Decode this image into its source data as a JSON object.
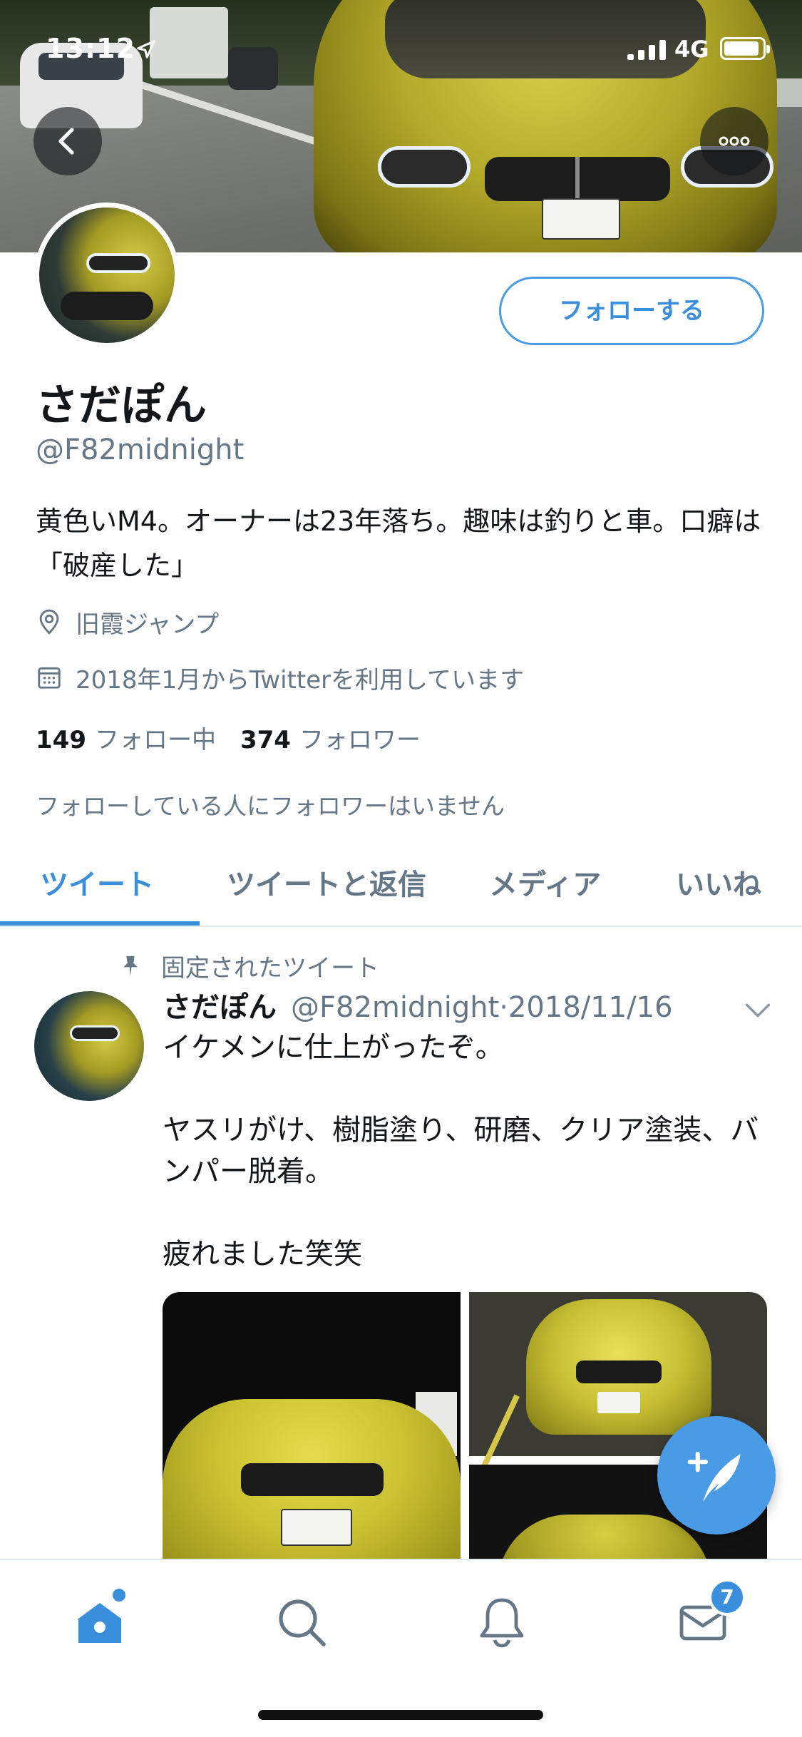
{
  "status_bar": {
    "time": "13:12",
    "network": "4G"
  },
  "profile": {
    "follow_label": "フォローする",
    "name": "さだぽん",
    "handle": "@F82midnight",
    "bio": "黄色いM4。オーナーは23年落ち。趣味は釣りと車。口癖は「破産した」",
    "location": "旧霞ジャンプ",
    "joined": "2018年1月からTwitterを利用しています",
    "following_count": "149",
    "following_label": "フォロー中",
    "followers_count": "374",
    "followers_label": "フォロワー",
    "followers_note": "フォローしている人にフォロワーはいません"
  },
  "tabs": [
    {
      "label": "ツイート",
      "active": true
    },
    {
      "label": "ツイートと返信",
      "active": false
    },
    {
      "label": "メディア",
      "active": false
    },
    {
      "label": "いいね",
      "active": false
    }
  ],
  "tweet": {
    "pinned_label": "固定されたツイート",
    "author_name": "さだぽん",
    "author_handle": "@F82midnight",
    "separator": "·",
    "date": "2018/11/16",
    "text": "イケメンに仕上がったぞ。\n\nヤスリがけ、樹脂塗り、研磨、クリア塗装、バンパー脱着。\n\n疲れました笑笑"
  },
  "bottom_nav": {
    "items": [
      "home-icon",
      "search-icon",
      "bell-icon",
      "mail-icon"
    ],
    "messages_badge": "7"
  },
  "colors": {
    "accent": "#3a8fdc",
    "secondary_text": "#657786",
    "primary_text": "#14171a"
  }
}
